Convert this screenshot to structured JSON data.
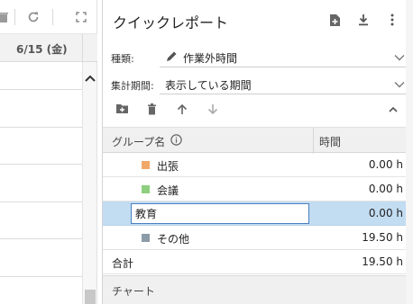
{
  "left_pane": {
    "date_header": "6/15 (金)",
    "icons": [
      "trash-icon",
      "refresh-icon",
      "expand-icon"
    ]
  },
  "panel": {
    "title": "クイックレポート",
    "header_icons": [
      "new-file-icon",
      "download-icon",
      "more-vertical-icon"
    ],
    "type_label": "種類:",
    "type_value": "作業外時間",
    "period_label": "集計期間:",
    "period_value": "表示している期間",
    "toolbar_icons": [
      "add-folder-icon",
      "trash-icon",
      "arrow-up-icon",
      "arrow-down-icon",
      "collapse-icon"
    ],
    "table": {
      "col_group": "グループ名",
      "col_time": "時間",
      "rows": [
        {
          "name": "出張",
          "time": "0.00 h",
          "color": "#f0a868"
        },
        {
          "name": "会議",
          "time": "0.00 h",
          "color": "#8ccf7e"
        },
        {
          "name": "教育",
          "time": "0.00 h",
          "color": "#6aa0d8",
          "editing": true
        },
        {
          "name": "その他",
          "time": "19.50 h",
          "color": "#8c9ba8"
        }
      ],
      "total_label": "合計",
      "total_time": "19.50 h"
    },
    "chart_section_label": "チャート"
  }
}
